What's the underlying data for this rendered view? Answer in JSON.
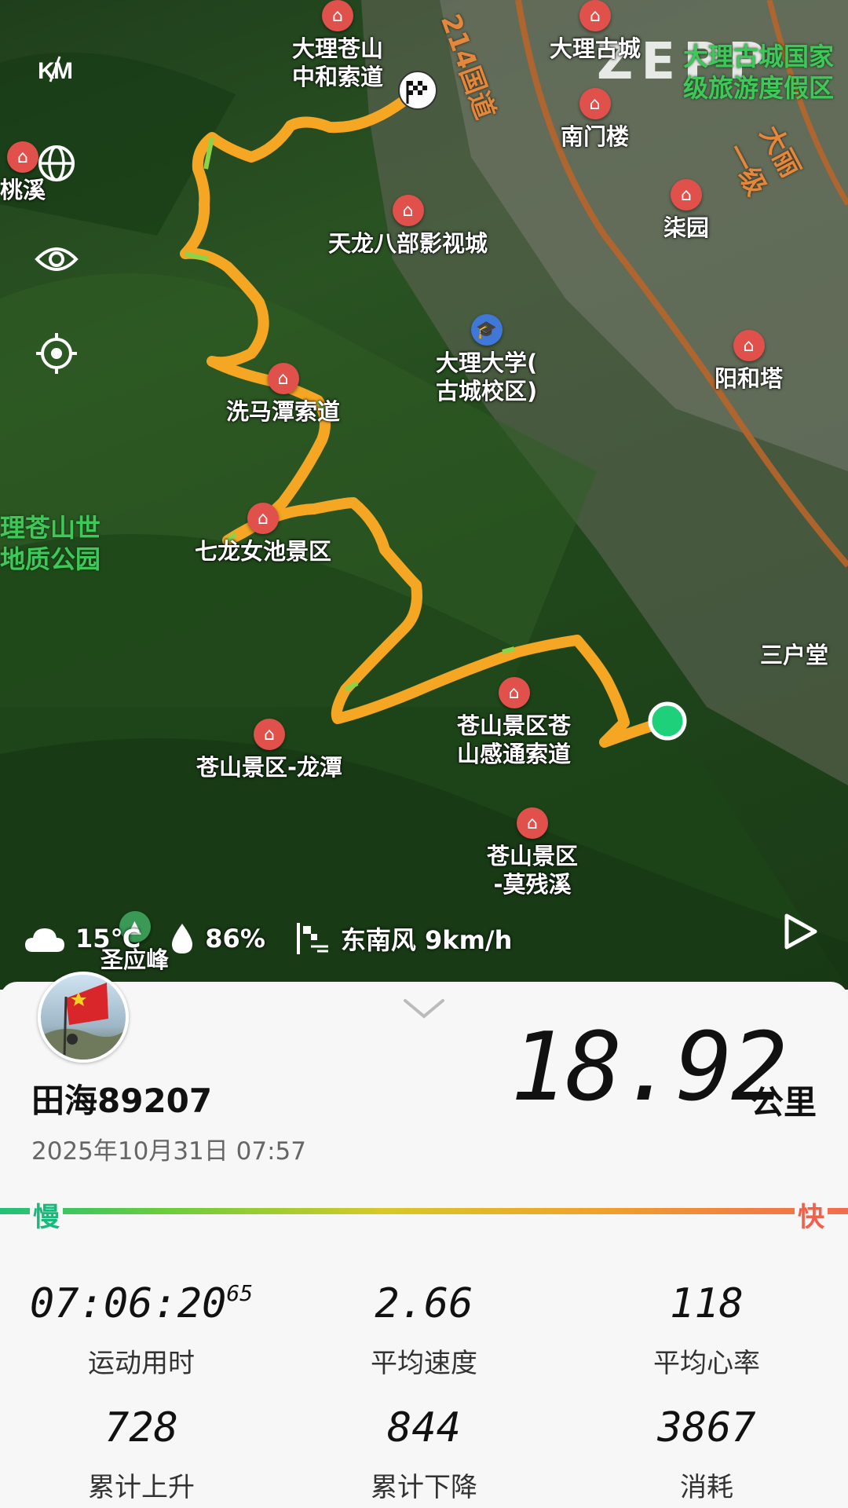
{
  "map": {
    "brand": "ZEPP",
    "road_labels": [
      "214国道",
      "大丽一级"
    ],
    "pois": [
      {
        "name": "大理苍山\n中和索道"
      },
      {
        "name": "大理古城"
      },
      {
        "name": "南门楼"
      },
      {
        "name": "桃溪"
      },
      {
        "name": "天龙八部影视城"
      },
      {
        "name": "柒园"
      },
      {
        "name": "大理大学(\n古城校区)"
      },
      {
        "name": "阳和塔"
      },
      {
        "name": "洗马潭索道"
      },
      {
        "name": "七龙女池景区"
      },
      {
        "name": "三户堂"
      },
      {
        "name": "苍山景区苍\n山感通索道"
      },
      {
        "name": "苍山景区-龙潭"
      },
      {
        "name": "苍山景区\n-莫残溪"
      },
      {
        "name": "圣应峰"
      }
    ],
    "area_labels": [
      "大理古城国家\n级旅游度假区",
      "理苍山世\n地质公园"
    ],
    "controls": [
      "km-icon",
      "globe-icon",
      "eye-icon",
      "locate-icon"
    ],
    "track_color": "#f5a623",
    "start_marker_color": "#1ed07a"
  },
  "weather": {
    "temperature": "15℃",
    "humidity": "86%",
    "wind": "东南风 9km/h"
  },
  "summary": {
    "username": "田海89207",
    "datetime": "2025年10月31日 07:57",
    "distance": "18.92",
    "distance_unit": "公里",
    "slow_label": "慢",
    "fast_label": "快"
  },
  "stats": [
    {
      "value": "07:06:20",
      "value_sup": "65",
      "label": "运动用时"
    },
    {
      "value": "2.66",
      "label": "平均速度"
    },
    {
      "value": "118",
      "label": "平均心率"
    },
    {
      "value": "728",
      "label": "累计上升"
    },
    {
      "value": "844",
      "label": "累计下降"
    },
    {
      "value": "3867",
      "label": "消耗"
    }
  ]
}
